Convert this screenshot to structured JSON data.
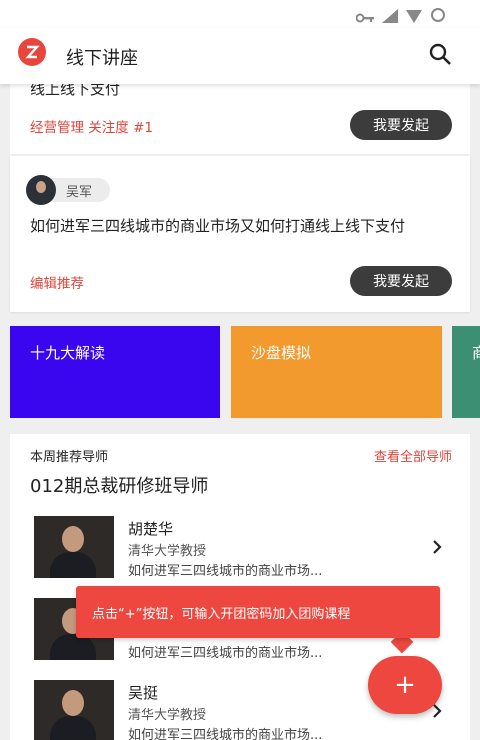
{
  "app": {
    "title": "线下讲座"
  },
  "lecture_cards": [
    {
      "title": "线上线下支付",
      "tag": "经营管理 关注度 #1",
      "button": "我要发起"
    },
    {
      "author": "吴军",
      "title": "如何进军三四线城市的商业市场又如何打通线上线下支付",
      "tag": "编辑推荐",
      "button": "我要发起"
    }
  ],
  "categories": [
    {
      "label": "十九大解读",
      "color": "#3a06f0"
    },
    {
      "label": "沙盘模拟",
      "color": "#f29a2e"
    },
    {
      "label": "商",
      "color": "#3c8f73"
    }
  ],
  "tutors_section": {
    "week_label": "本周推荐导师",
    "see_all": "查看全部导师",
    "class_title": "012期总裁研修班导师",
    "tutors": [
      {
        "name": "胡楚华",
        "role": "清华大学教授",
        "desc": "如何进军三四线城市的商业市场..."
      },
      {
        "name": "",
        "role": "",
        "desc": "如何进军三四线城市的商业市场..."
      },
      {
        "name": "吴挺",
        "role": "清华大学教授",
        "desc": "如何进军三四线城市的商业市场..."
      }
    ]
  },
  "toast": {
    "text": "点击“+”按钮，可输入开团密码加入团购课程"
  },
  "fab": {
    "label": "+"
  },
  "colors": {
    "accent": "#ed473f",
    "dark_button": "#3c3c3c"
  }
}
